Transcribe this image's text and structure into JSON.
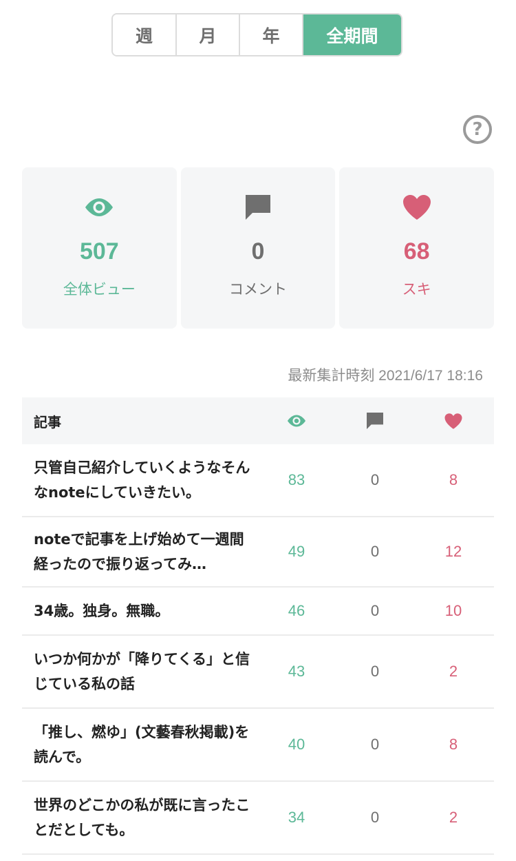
{
  "period_tabs": {
    "week": "週",
    "month": "月",
    "year": "年",
    "all": "全期間"
  },
  "summary": {
    "views": {
      "value": "507",
      "label": "全体ビュー"
    },
    "comments": {
      "value": "0",
      "label": "コメント"
    },
    "likes": {
      "value": "68",
      "label": "スキ"
    }
  },
  "updated": "最新集計時刻 2021/6/17 18:16",
  "table": {
    "header": {
      "title": "記事"
    },
    "rows": [
      {
        "title": "只管自己紹介していくようなそんなnoteにしていきたい。",
        "views": "83",
        "comments": "0",
        "likes": "8"
      },
      {
        "title": "noteで記事を上げ始めて一週間経ったので振り返ってみ…",
        "views": "49",
        "comments": "0",
        "likes": "12"
      },
      {
        "title": "34歳。独身。無職。",
        "views": "46",
        "comments": "0",
        "likes": "10"
      },
      {
        "title": "いつか何かが「降りてくる」と信じている私の話",
        "views": "43",
        "comments": "0",
        "likes": "2"
      },
      {
        "title": "「推し、燃ゆ」(文藝春秋掲載)を読んで。",
        "views": "40",
        "comments": "0",
        "likes": "8"
      },
      {
        "title": "世界のどこかの私が既に言ったことだとしても。",
        "views": "34",
        "comments": "0",
        "likes": "2"
      }
    ]
  },
  "colors": {
    "accent_green": "#5cb897",
    "accent_red": "#d75f77",
    "icon_gray": "#6f6f6f"
  },
  "icons": {
    "views": "eye-icon",
    "comments": "comment-icon",
    "likes": "heart-icon",
    "help": "help-icon"
  }
}
